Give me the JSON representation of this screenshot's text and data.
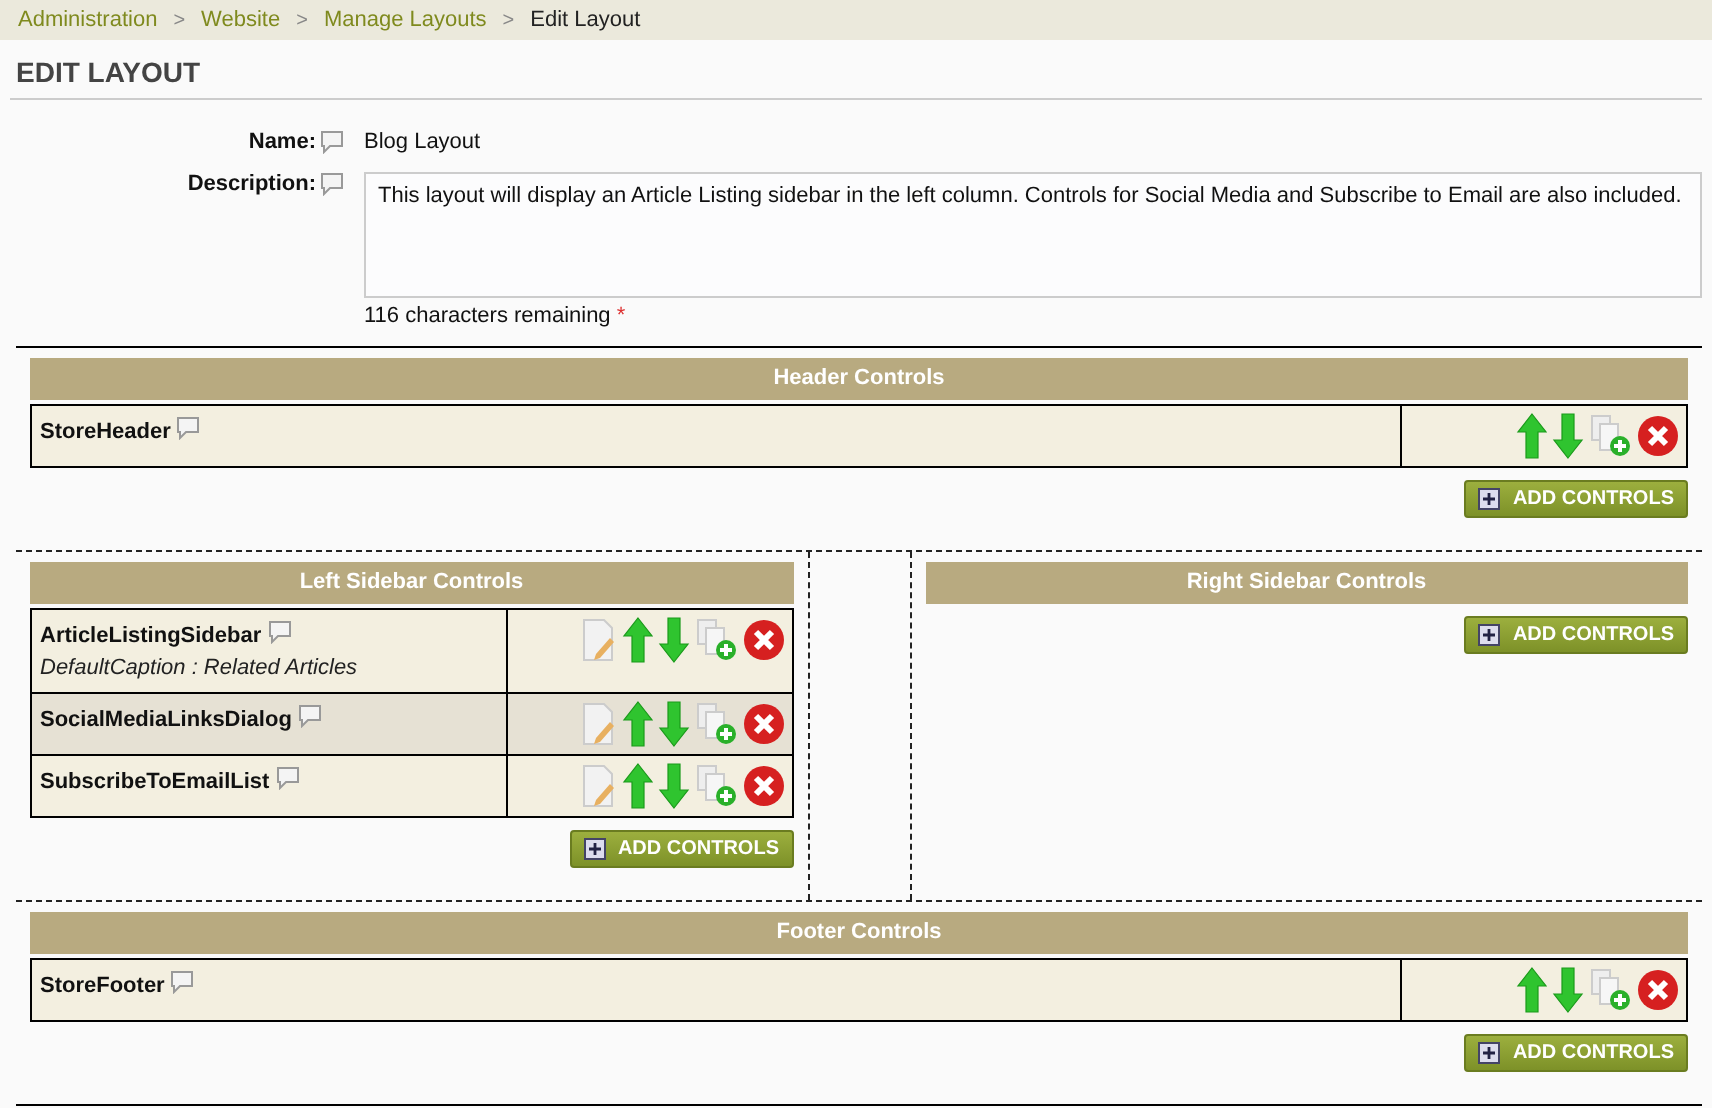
{
  "breadcrumb": [
    {
      "label": "Administration",
      "current": false
    },
    {
      "separator": ">",
      "label": "Website",
      "current": false
    },
    {
      "separator": ">",
      "label": "Manage Layouts",
      "current": false
    },
    {
      "separator": ">",
      "label": "Edit Layout",
      "current": true
    }
  ],
  "page_title": "EDIT LAYOUT",
  "form": {
    "name_label": "Name:",
    "name_value": "Blog Layout",
    "description_label": "Description:",
    "description_value": "This layout will display an Article Listing sidebar in the left column.  Controls for Social Media and Subscribe to Email are also included.",
    "remaining": "116 characters remaining",
    "required_mark": "*"
  },
  "header_zone": {
    "title": "Header Controls",
    "add_button": "ADD CONTROLS",
    "controls": [
      {
        "name": "StoreHeader",
        "editable": false,
        "highlighted": false
      }
    ]
  },
  "sidebars": [
    {
      "title": "Left Sidebar Controls",
      "add_button": "ADD CONTROLS",
      "controls": [
        {
          "name": "ArticleListingSidebar",
          "caption": "DefaultCaption : Related Articles",
          "editable": true,
          "highlighted": false
        },
        {
          "name": "SocialMediaLinksDialog",
          "editable": true,
          "highlighted": true
        },
        {
          "name": "SubscribeToEmailList",
          "editable": true,
          "highlighted": false
        }
      ]
    },
    {
      "title": "Right Sidebar Controls",
      "add_button": "ADD CONTROLS"
    }
  ],
  "footer_zone": {
    "title": "Footer Controls",
    "add_button": "ADD CONTROLS",
    "controls": [
      {
        "name": "StoreFooter",
        "editable": false,
        "highlighted": false
      }
    ]
  }
}
